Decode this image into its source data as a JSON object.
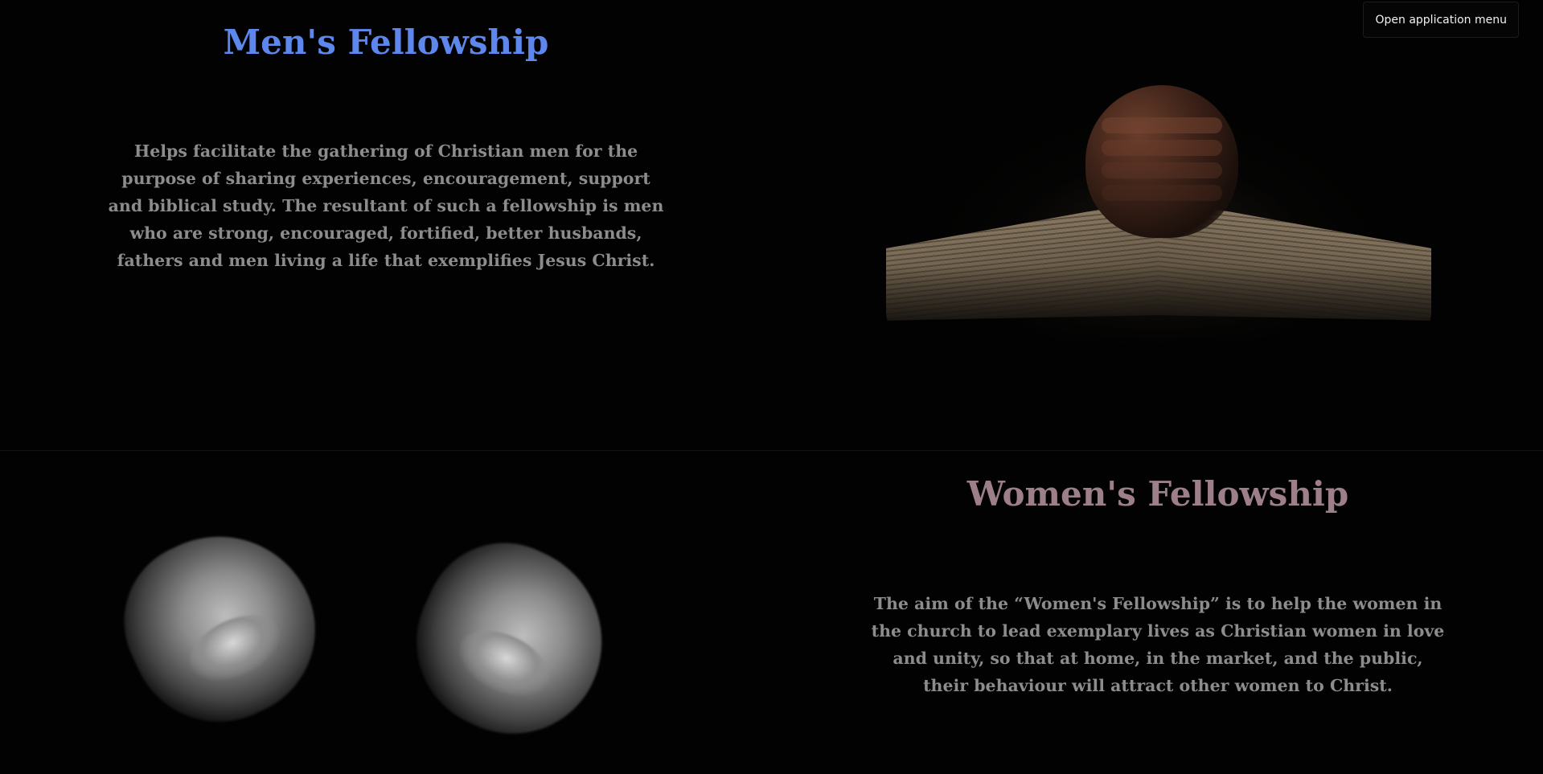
{
  "app_menu": {
    "label": "Open application menu"
  },
  "men_section": {
    "title": "Men's Fellowship",
    "description": "Helps facilitate the gathering of Christian men for the purpose of sharing experiences, encouragement, support and biblical study. The resultant of such a fellowship is men who are strong, encouraged, fortified, better husbands, fathers and men living a life that exemplifies Jesus Christ.",
    "image_icon": "praying-hands-on-bible-image"
  },
  "women_section": {
    "title": "Women's Fellowship",
    "description": "The aim of the “Women's Fellowship” is to help the women in the church to lead exemplary lives as Christian women in love and unity, so that at home, in the market, and the public, their behaviour will attract other women to Christ.",
    "image_icon": "open-hands-image"
  },
  "colors": {
    "background": "#020202",
    "men_title": "#5e87ee",
    "women_title": "#9d7f89",
    "body_text": "#8c8c8c"
  }
}
